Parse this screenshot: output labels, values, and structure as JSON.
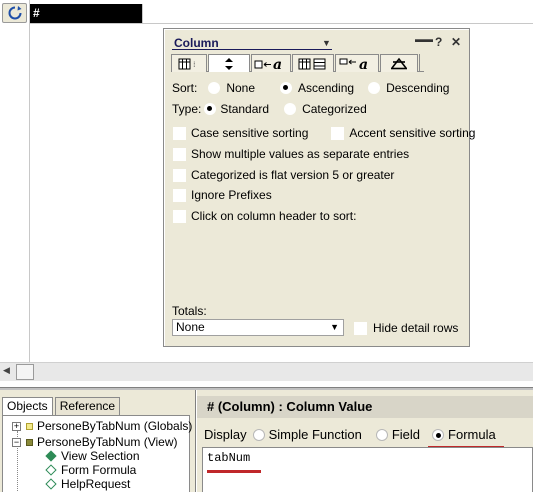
{
  "colors": {
    "dialog_bg": "#ece9d8",
    "column_header_bg": "#000000",
    "annotation_underline": "#c0282a",
    "selection_diamond": "#2e8b57"
  },
  "view": {
    "refresh_icon": "refresh-icon",
    "column_header_label": "#"
  },
  "dialog": {
    "title": "Column",
    "controls": {
      "menu": "▬▬",
      "help": "?",
      "close": "✕"
    },
    "tabs": [
      {
        "icon": "column-info-icon"
      },
      {
        "icon": "sort-icon"
      },
      {
        "icon": "font-icon"
      },
      {
        "icon": "numbers-icon"
      },
      {
        "icon": "title-font-icon"
      },
      {
        "icon": "advanced-icon"
      }
    ],
    "sort": {
      "label": "Sort:",
      "options": [
        "None",
        "Ascending",
        "Descending"
      ],
      "selected": "Ascending"
    },
    "type": {
      "label": "Type:",
      "options": [
        "Standard",
        "Categorized"
      ],
      "selected": "Standard"
    },
    "checks": {
      "case_sensitive": "Case sensitive sorting",
      "accent_sensitive": "Accent sensitive sorting",
      "multiple_values": "Show multiple values as separate entries",
      "categorized_flat": "Categorized is flat version 5 or greater",
      "ignore_prefixes": "Ignore Prefixes",
      "click_header": "Click on column header to sort:"
    },
    "totals": {
      "label": "Totals:",
      "value": "None",
      "hide_detail": "Hide detail rows"
    }
  },
  "objects_pane": {
    "tabs": [
      "Objects",
      "Reference"
    ],
    "active_tab": "Objects",
    "tree": [
      {
        "label": "PersoneByTabNum (Globals)",
        "expander": "+"
      },
      {
        "label": "PersoneByTabNum (View)",
        "expander": "−"
      },
      {
        "label": "View Selection"
      },
      {
        "label": "Form Formula"
      },
      {
        "label": "HelpRequest"
      }
    ]
  },
  "programmer_pane": {
    "title": "# (Column) : Column Value",
    "display_label": "Display",
    "options": [
      "Simple Function",
      "Field",
      "Formula"
    ],
    "selected": "Formula",
    "code": "tabNum"
  }
}
